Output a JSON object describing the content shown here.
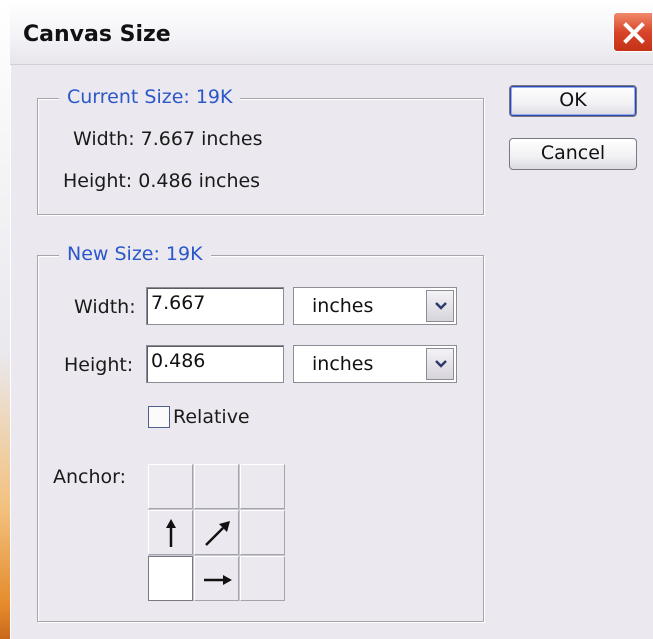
{
  "window": {
    "title": "Canvas Size"
  },
  "icons": {
    "close": "close-icon",
    "dropdown": "chevron-down-icon",
    "anchor_arrows": [
      "arrow-up-icon",
      "arrow-up-right-icon",
      "arrow-right-icon"
    ]
  },
  "current_size": {
    "legend": "Current Size:  19K",
    "width_text": "Width: 7.667 inches",
    "height_text": "Height: 0.486 inches"
  },
  "new_size": {
    "legend": "New Size:  19K",
    "width_label": "Width:",
    "width_value": "7.667",
    "width_unit": "inches",
    "height_label": "Height:",
    "height_value": "0.486",
    "height_unit": "inches",
    "relative_label": "Relative",
    "relative_checked": false,
    "anchor_label": "Anchor:",
    "anchor_selected": "bottom-left"
  },
  "buttons": {
    "ok": "OK",
    "cancel": "Cancel"
  },
  "colors": {
    "legend": "#2b57c8",
    "close_button": "#d9452a",
    "dialog_bg": "#ebe9ef"
  }
}
